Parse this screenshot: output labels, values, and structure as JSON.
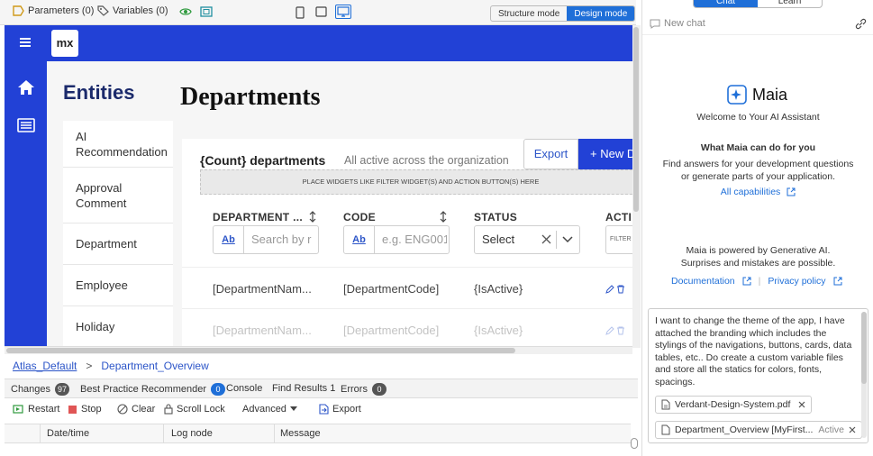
{
  "toolbar": {
    "parameters_label": "Parameters (0)",
    "variables_label": "Variables (0)",
    "structure_mode": "Structure mode",
    "design_mode": "Design mode"
  },
  "app": {
    "logo": "mx",
    "entities_title": "Entities",
    "page_heading": "Departments",
    "entity_items": [
      "AI Recommendation",
      "Approval Comment",
      "Department",
      "Employee",
      "Holiday"
    ],
    "count_title": "{Count} departments",
    "count_subtitle": "All active across the organization",
    "export_label": "Export",
    "new_label": "+ New D",
    "placeholder_bar": "PLACE WIDGETS LIKE FILTER WIDGET(S) AND ACTION BUTTON(S) HERE",
    "columns": {
      "department": "DEPARTMENT ...",
      "code": "CODE",
      "status": "STATUS",
      "actions": "ACTI"
    },
    "filters": {
      "ab_label": "Ab",
      "department_placeholder": "Search by r",
      "code_placeholder": "e.g. ENG001",
      "status_select": "Select",
      "actions_filter": "FILTER"
    },
    "rows": [
      {
        "department": "[DepartmentNam...",
        "code": "[DepartmentCode]",
        "status": "{IsActive}"
      },
      {
        "department": "[DepartmentNam...",
        "code": "[DepartmentCode]",
        "status": "{IsActive}"
      }
    ]
  },
  "breadcrumb": {
    "root": "Atlas_Default",
    "separator": ">",
    "page": "Department_Overview"
  },
  "bottom_tabs": {
    "changes": "Changes",
    "changes_count": "97",
    "best_practice": "Best Practice Recommender",
    "best_practice_count": "0",
    "console": "Console",
    "find_results": "Find Results 1",
    "errors": "Errors",
    "errors_count": "0"
  },
  "console_bar": {
    "restart": "Restart",
    "stop": "Stop",
    "clear": "Clear",
    "scroll_lock": "Scroll Lock",
    "advanced": "Advanced",
    "export": "Export"
  },
  "log_columns": [
    "Date/time",
    "Log node",
    "Message"
  ],
  "chat": {
    "tab_chat": "Chat",
    "tab_learn": "Learn",
    "new_chat": "New chat",
    "title": "Maia",
    "welcome": "Welcome to Your AI Assistant",
    "what_title": "What Maia can do for you",
    "what_body_1": "Find answers for your development questions",
    "what_body_2": "or generate parts of your application.",
    "all_capabilities": "All capabilities",
    "powered_1": "Maia is powered by Generative AI.",
    "powered_2": "Surprises and mistakes are possible.",
    "documentation": "Documentation",
    "privacy_policy": "Privacy policy",
    "prompt_text": "I want to change the theme of the app, I have attached the branding which includes the stylings of the navigations, buttons, cards, data tables, etc.. Do create a custom variable files and store all the statics for colors, fonts, spacings.",
    "attachment_1": "Verdant-Design-System.pdf",
    "attachment_2": "Department_Overview [MyFirst...",
    "attachment_2_status": "Active"
  },
  "colors": {
    "brand_blue": "#2241d6",
    "accent_blue": "#1f6fd8",
    "link_blue": "#2c55c8"
  }
}
